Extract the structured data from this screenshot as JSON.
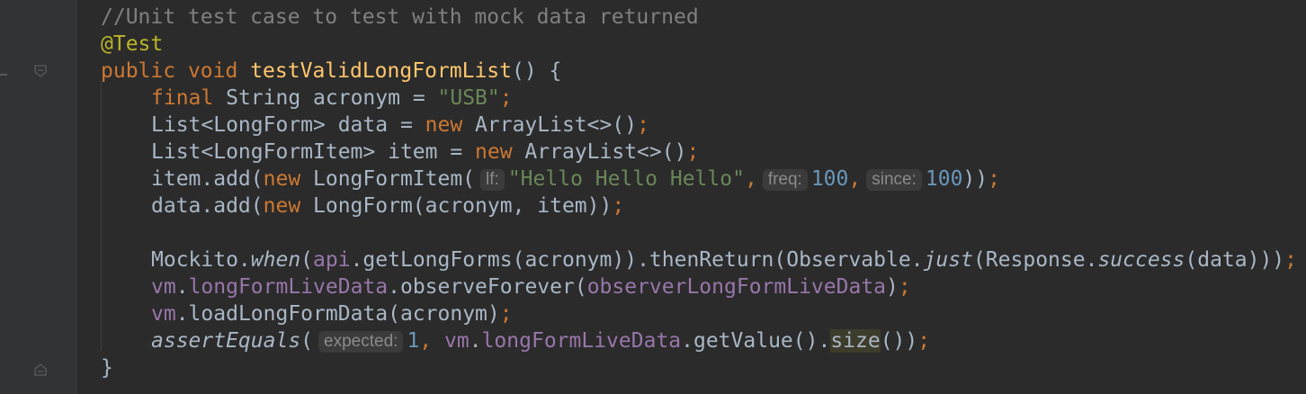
{
  "editor": {
    "lines": {
      "l1": {
        "comment": "//Unit test case to test with mock data returned"
      },
      "l2": {
        "annotation": "@Test"
      },
      "l3": {
        "kw_public": "public",
        "kw_void": "void",
        "method": "testValidLongFormList",
        "rest": "() {"
      },
      "l4": {
        "kw_final": "final",
        "type": "String acronym = ",
        "str": "\"USB\"",
        "semi": ";"
      },
      "l5": {
        "pre": "List<LongForm> data = ",
        "kw_new": "new",
        "post": " ArrayList<>()",
        "semi": ";"
      },
      "l6": {
        "pre": "List<LongFormItem> item = ",
        "kw_new": "new",
        "post": " ArrayList<>()",
        "semi": ";"
      },
      "l7": {
        "pre": "item.add(",
        "kw_new": "new",
        "cls": " LongFormItem(",
        "hint_lf": "lf:",
        "str": "\"Hello Hello Hello\"",
        "comma1": ",",
        "hint_freq": "freq:",
        "num1": "100",
        "comma2": ",",
        "hint_since": "since:",
        "num2": "100",
        "close": "))",
        "semi": ";"
      },
      "l8": {
        "pre": "data.add(",
        "kw_new": "new",
        "post": " LongForm(acronym, item))",
        "semi": ";"
      },
      "l10": {
        "pre": "Mockito.",
        "when": "when",
        "p1": "(",
        "api": "api",
        "p2": ".getLongForms(acronym)).thenReturn(Observable.",
        "just": "just",
        "p3": "(Response.",
        "success": "success",
        "p4": "(data)))",
        "semi": ";"
      },
      "l11": {
        "vm": "vm",
        "dot": ".",
        "field": "longFormLiveData",
        "mid": ".observeForever(",
        "field2": "observerLongFormLiveData",
        "close": ")",
        "semi": ";"
      },
      "l12": {
        "vm": "vm",
        "rest": ".loadLongFormData(acronym)",
        "semi": ";"
      },
      "l13": {
        "assert": "assertEquals",
        "open": "(",
        "hint_expected": "expected:",
        "num": "1",
        "comma": ",",
        "vm": "vm",
        "dot": ".",
        "field": "longFormLiveData",
        "mid": ".getValue().",
        "size": "size",
        "close": "())",
        "semi": ";"
      },
      "l14": {
        "brace": "}"
      }
    }
  },
  "colors": {
    "background": "#2b2b2b",
    "keyword": "#cc7832",
    "string": "#6a8759",
    "number": "#6897bb",
    "field": "#9876aa",
    "method_decl": "#ffc66d",
    "annotation": "#bbb529",
    "comment": "#808080"
  }
}
